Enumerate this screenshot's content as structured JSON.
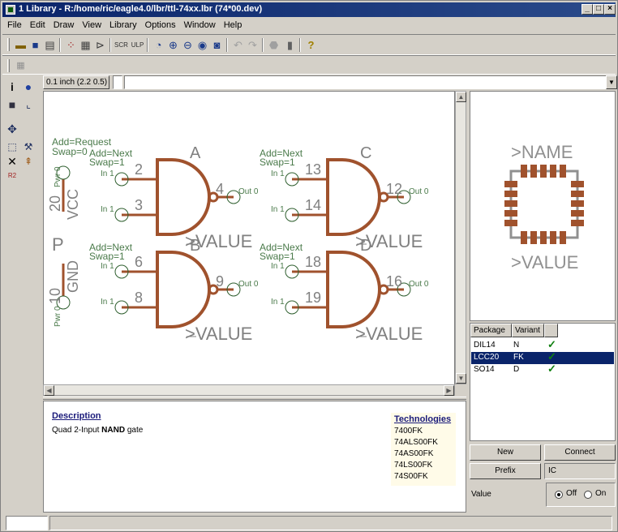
{
  "window": {
    "title": "1 Library - R:/home/ric/eagle4.0/lbr/ttl-74xx.lbr (74*00.dev)"
  },
  "menu": [
    "File",
    "Edit",
    "Draw",
    "View",
    "Library",
    "Options",
    "Window",
    "Help"
  ],
  "toolbar": {
    "icons": [
      "open-icon",
      "save-icon",
      "print-icon",
      "board-icon",
      "schematic-icon",
      "package-icon",
      "script-icon",
      "ulp-icon",
      "zoom-fit-icon",
      "zoom-in-icon",
      "zoom-out-icon",
      "zoom-redraw-icon",
      "zoom-select-icon",
      "undo-icon",
      "redo-icon",
      "stop-icon",
      "go-icon",
      "help-icon"
    ]
  },
  "param_bar": {
    "grid": "0.1 inch (2.2 0.5)",
    "command": ""
  },
  "schematic": {
    "colors": {
      "gate": "#a0522d",
      "pin": "#2e5e2e",
      "text": "#4a7a4a",
      "outline": "#808080"
    },
    "gate_labels": [
      "A",
      "B",
      "C",
      "D"
    ],
    "value_label": ">VALUE",
    "add_request": "Add=Request",
    "swap_0": "Swap=0",
    "add_next": "Add=Next",
    "swap_1": "Swap=1",
    "pins": {
      "a_in1": "2",
      "a_in2": "3",
      "a_out": "4",
      "b_in1": "6",
      "b_in2": "8",
      "b_out": "9",
      "c_in1": "13",
      "c_in2": "14",
      "c_out": "12",
      "d_in1": "18",
      "d_in2": "19",
      "d_out": "16"
    },
    "pin_in_label": "In 1",
    "pin_out_label": "Out 0",
    "pwr_label": "Pwr 0",
    "vcc": "VCC",
    "vcc_pin": "20",
    "gnd": "GND",
    "gnd_pin": "10",
    "p_label": "P"
  },
  "preview": {
    "name_label": ">NAME",
    "value_label": ">VALUE"
  },
  "package_table": {
    "headers": [
      "Package",
      "Variant"
    ],
    "rows": [
      {
        "package": "DIL14",
        "variant": "N",
        "selected": false
      },
      {
        "package": "LCC20",
        "variant": "FK",
        "selected": true
      },
      {
        "package": "SO14",
        "variant": "D",
        "selected": false
      }
    ]
  },
  "buttons": {
    "new": "New",
    "connect": "Connect",
    "prefix": "Prefix",
    "prefix_value": "IC",
    "value_label": "Value",
    "off": "Off",
    "on": "On"
  },
  "description": {
    "title": "Description",
    "text_prefix": "Quad 2-Input ",
    "text_bold": "NAND",
    "text_suffix": " gate"
  },
  "technologies": {
    "title": "Technologies",
    "items": [
      "7400FK",
      "74ALS00FK",
      "74AS00FK",
      "74LS00FK",
      "74S00FK"
    ]
  }
}
